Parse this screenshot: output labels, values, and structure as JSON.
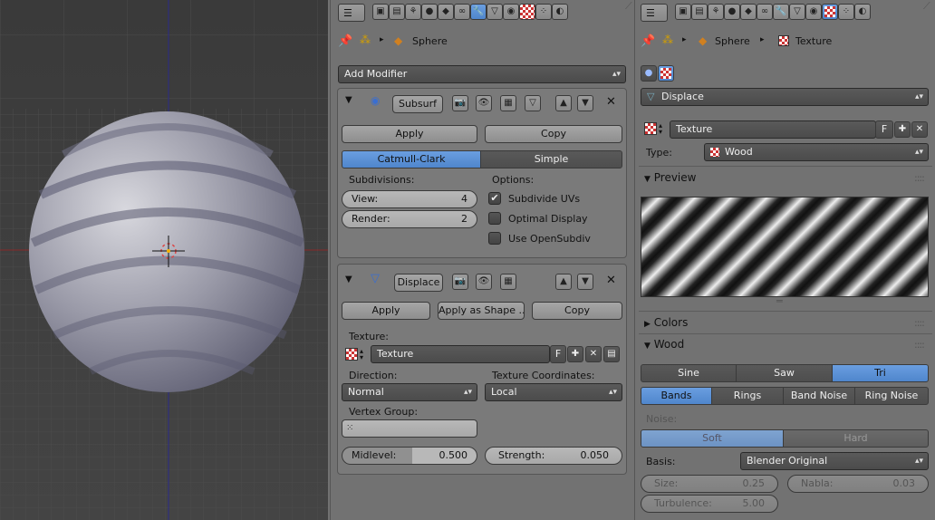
{
  "viewport": {
    "object_shape": "sphere",
    "grid": true,
    "colors": {
      "background": "#3d3d3d",
      "grid": "#4a4a4a",
      "x_axis": "#8a2a2a",
      "y_axis": "#2a2a8a"
    }
  },
  "modifiers_panel": {
    "breadcrumb": {
      "object": "Sphere"
    },
    "add_modifier_label": "Add Modifier",
    "subsurf": {
      "name": "Subsurf",
      "apply_label": "Apply",
      "copy_label": "Copy",
      "mode_catmull": "Catmull-Clark",
      "mode_simple": "Simple",
      "subdivisions_label": "Subdivisions:",
      "view_label": "View:",
      "view_value": "4",
      "render_label": "Render:",
      "render_value": "2",
      "options_label": "Options:",
      "opt_subdivide_uvs": "Subdivide UVs",
      "opt_optimal_display": "Optimal Display",
      "opt_use_opensubdiv": "Use OpenSubdiv"
    },
    "displace": {
      "name": "Displace",
      "apply_label": "Apply",
      "apply_shape_label": "Apply as Shape ...",
      "copy_label": "Copy",
      "texture_label": "Texture:",
      "texture_value": "Texture",
      "texture_f": "F",
      "direction_label": "Direction:",
      "direction_value": "Normal",
      "texcoords_label": "Texture Coordinates:",
      "texcoords_value": "Local",
      "vertex_group_label": "Vertex Group:",
      "midlevel_label": "Midlevel:",
      "midlevel_value": "0.500",
      "strength_label": "Strength:",
      "strength_value": "0.050"
    }
  },
  "texture_panel": {
    "breadcrumb": {
      "object": "Sphere",
      "texture": "Texture"
    },
    "modifier_dropdown": "Displace",
    "texture_name": "Texture",
    "texture_f": "F",
    "type_label": "Type:",
    "type_value": "Wood",
    "preview_label": "Preview",
    "colors_label": "Colors",
    "wood_label": "Wood",
    "wave_sine": "Sine",
    "wave_saw": "Saw",
    "wave_tri": "Tri",
    "band_bands": "Bands",
    "band_rings": "Rings",
    "band_noise": "Band Noise",
    "band_ring_noise": "Ring Noise",
    "noise_label": "Noise:",
    "noise_soft": "Soft",
    "noise_hard": "Hard",
    "basis_label": "Basis:",
    "basis_value": "Blender Original",
    "size_label": "Size:",
    "size_value": "0.25",
    "nabla_label": "Nabla:",
    "nabla_value": "0.03",
    "turbulence_label": "Turbulence:",
    "turbulence_value": "5.00"
  }
}
